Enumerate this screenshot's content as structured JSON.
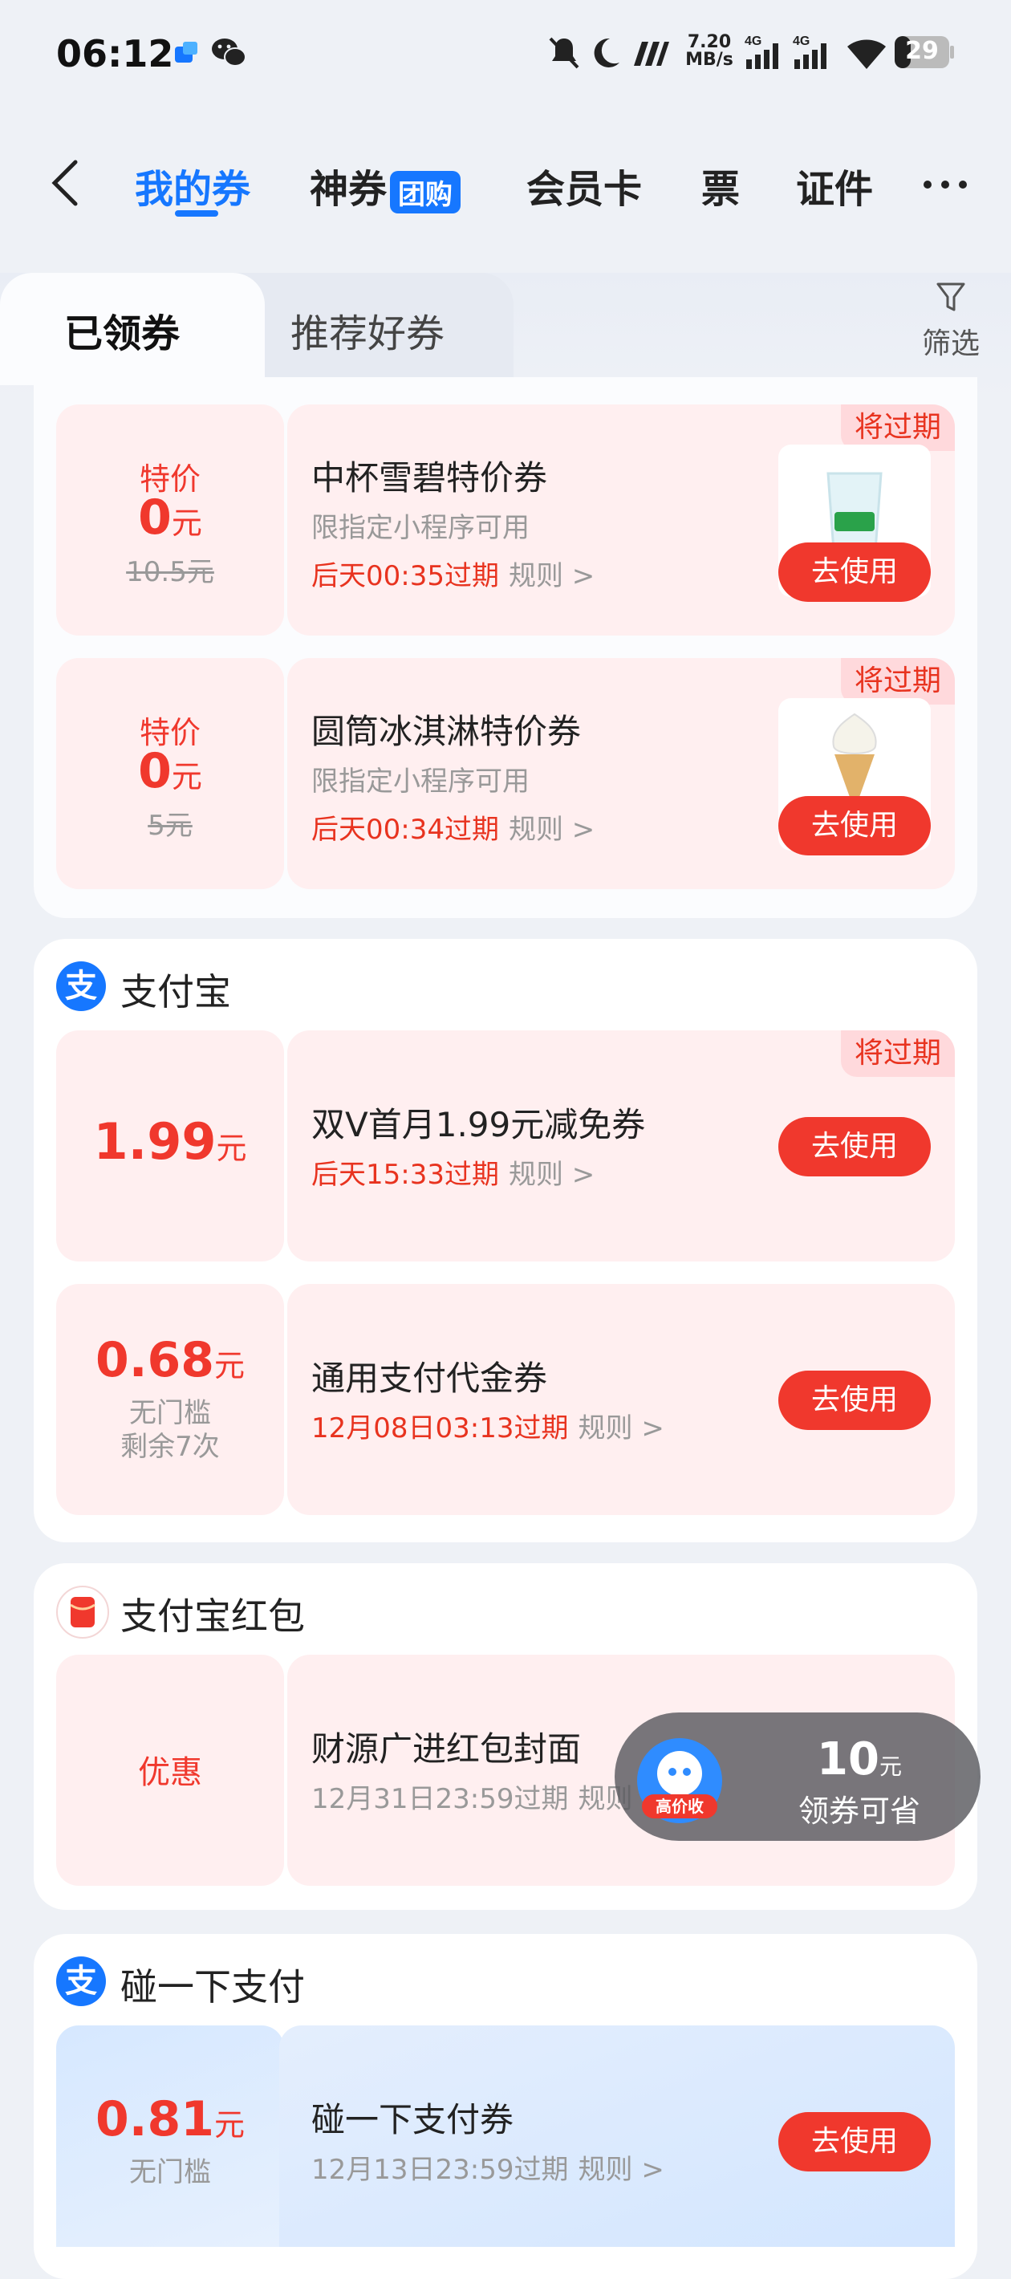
{
  "status_bar": {
    "time": "06:12",
    "net_speed_value": "7.20",
    "net_speed_unit": "MB/s",
    "signal1": "4G",
    "signal2": "4G",
    "battery": "29",
    "icons": [
      "app-icon",
      "wechat-icon",
      "mute-icon",
      "moon-icon",
      "nfc-icon",
      "signal-icon",
      "signal-icon",
      "wifi-icon",
      "battery-icon"
    ]
  },
  "nav": {
    "tabs": [
      {
        "label": "我的券",
        "active": true
      },
      {
        "label": "神券",
        "badge": "团购"
      },
      {
        "label": "会员卡"
      },
      {
        "label": "票"
      },
      {
        "label": "证件"
      }
    ],
    "more": "···"
  },
  "segment": {
    "tabs": [
      "已领券",
      "推荐好券"
    ],
    "filter": "筛选"
  },
  "sections": {
    "alipay": {
      "title": "支付宝",
      "icon_letter": "支"
    },
    "hongbao": {
      "title": "支付宝红包"
    },
    "peng": {
      "title": "碰一下支付",
      "icon_letter": "支"
    }
  },
  "coupons": {
    "c1": {
      "price_label": "特价",
      "price": "0",
      "unit": "元",
      "original": "10.5元",
      "title": "中杯雪碧特价券",
      "desc": "限指定小程序可用",
      "expire": "后天00:35过期",
      "rule": "规则 >",
      "tag": "将过期",
      "button": "去使用"
    },
    "c2": {
      "price_label": "特价",
      "price": "0",
      "unit": "元",
      "original": "5元",
      "title": "圆筒冰淇淋特价券",
      "desc": "限指定小程序可用",
      "expire": "后天00:34过期",
      "rule": "规则 >",
      "tag": "将过期",
      "button": "去使用"
    },
    "c3": {
      "price": "1.99",
      "unit": "元",
      "title": "双V首月1.99元减免券",
      "expire": "后天15:33过期",
      "rule": "规则 >",
      "tag": "将过期",
      "button": "去使用"
    },
    "c4": {
      "price": "0.68",
      "unit": "元",
      "line1": "无门槛",
      "line2": "剩余7次",
      "title": "通用支付代金券",
      "expire": "12月08日03:13过期",
      "rule": "规则 >",
      "button": "去使用"
    },
    "c5": {
      "price_text": "优惠",
      "title": "财源广进红包封面",
      "expire": "12月31日23:59过期",
      "rule": "规则"
    },
    "c6": {
      "price": "0.81",
      "unit": "元",
      "line1": "无门槛",
      "title": "碰一下支付券",
      "expire": "12月13日23:59过期",
      "rule": "规则 >",
      "button": "去使用"
    }
  },
  "floating": {
    "badge": "高价收",
    "amount": "10",
    "unit": "元",
    "text": "领券可省"
  },
  "colors": {
    "brand": "#1677ff",
    "red": "#f0382d",
    "coupon_bg": "#ffeff0"
  }
}
